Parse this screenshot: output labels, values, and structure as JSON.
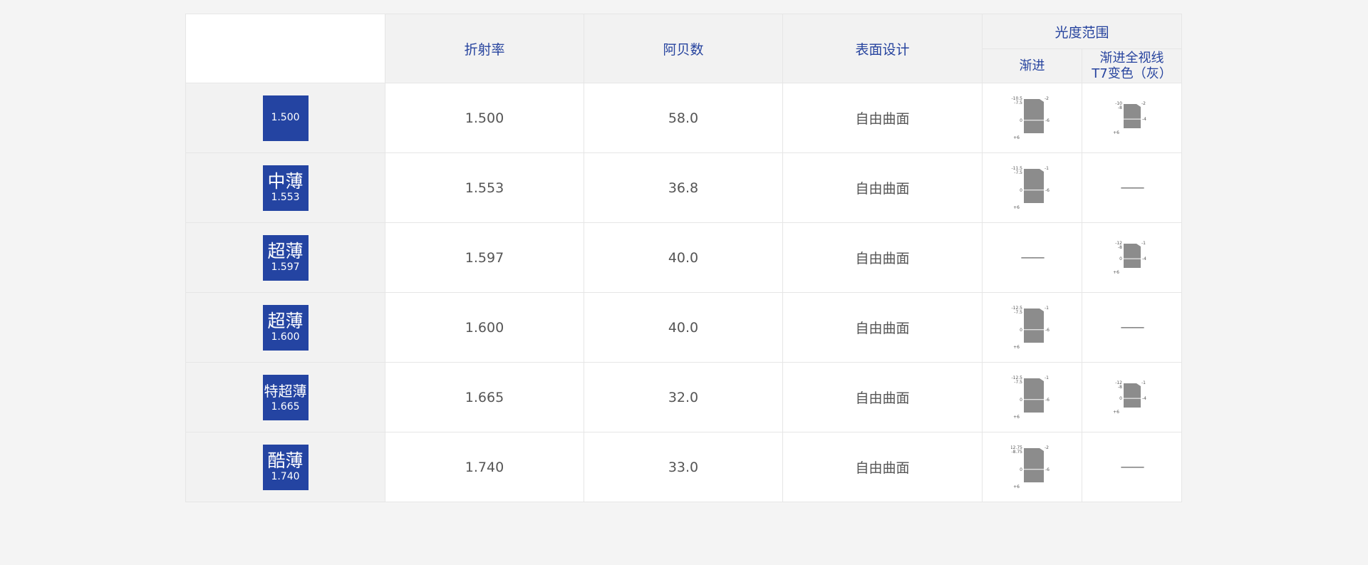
{
  "header": {
    "refractive_index": "折射率",
    "abbe_number": "阿贝数",
    "surface_design": "表面设计",
    "power_range": "光度范围",
    "progressive": "渐进",
    "photochromic_line1": "渐进全视线",
    "photochromic_line2": "T7变色（灰）"
  },
  "rows": [
    {
      "badge_name": "",
      "badge_num": "1.500",
      "index": "1.500",
      "abbe": "58.0",
      "surface": "自由曲面",
      "progressive": {
        "show": true,
        "top": "-10.5",
        "mid": "-7.5",
        "zero": "0",
        "bottom": "+6",
        "right_top": "-2",
        "right_mid": "-6"
      },
      "photo": {
        "show": true,
        "top": "-10",
        "mid": "-8",
        "zero": "",
        "bottom": "+6",
        "right_top": "-2",
        "right_mid": "-4"
      },
      "dash": "——"
    },
    {
      "badge_name": "中薄",
      "badge_num": "1.553",
      "index": "1.553",
      "abbe": "36.8",
      "surface": "自由曲面",
      "progressive": {
        "show": true,
        "top": "-11.5",
        "mid": "-7.5",
        "zero": "0",
        "bottom": "+6",
        "right_top": "-1",
        "right_mid": "-6"
      },
      "photo": {
        "show": false
      },
      "dash": "——"
    },
    {
      "badge_name": "超薄",
      "badge_num": "1.597",
      "index": "1.597",
      "abbe": "40.0",
      "surface": "自由曲面",
      "progressive": {
        "show": false
      },
      "photo": {
        "show": true,
        "top": "-12",
        "mid": "-8",
        "zero": "0",
        "bottom": "+6",
        "right_top": "-1",
        "right_mid": "-4"
      },
      "dash": "——"
    },
    {
      "badge_name": "超薄",
      "badge_num": "1.600",
      "index": "1.600",
      "abbe": "40.0",
      "surface": "自由曲面",
      "progressive": {
        "show": true,
        "top": "-12.5",
        "mid": "-7.5",
        "zero": "0",
        "bottom": "+6",
        "right_top": "-1",
        "right_mid": "-6"
      },
      "photo": {
        "show": false
      },
      "dash": "——"
    },
    {
      "badge_name": "特超薄",
      "badge_num": "1.665",
      "index": "1.665",
      "abbe": "32.0",
      "surface": "自由曲面",
      "progressive": {
        "show": true,
        "top": "-12.5",
        "mid": "-7.5",
        "zero": "0",
        "bottom": "+6",
        "right_top": "-1",
        "right_mid": "-6"
      },
      "photo": {
        "show": true,
        "top": "-12",
        "mid": "-8",
        "zero": "0",
        "bottom": "+6",
        "right_top": "-1",
        "right_mid": "-4"
      },
      "dash": "——"
    },
    {
      "badge_name": "酷薄",
      "badge_num": "1.740",
      "index": "1.740",
      "abbe": "33.0",
      "surface": "自由曲面",
      "progressive": {
        "show": true,
        "top": "-12.75",
        "mid": "-8.75",
        "zero": "0",
        "bottom": "+6",
        "right_top": "-2",
        "right_mid": "-6"
      },
      "photo": {
        "show": false
      },
      "dash": "——"
    }
  ],
  "colors": {
    "badge": "#2444a2",
    "header_text": "#26439e",
    "diagram_fill": "#8c8c8c"
  }
}
